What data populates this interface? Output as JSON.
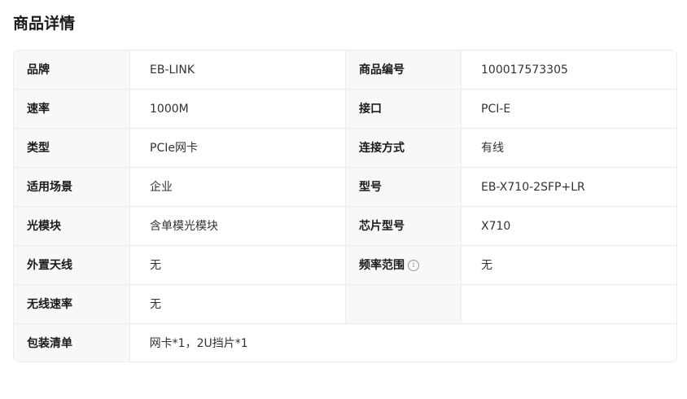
{
  "section": {
    "title": "商品详情"
  },
  "specs": {
    "rows": [
      {
        "k1": "品牌",
        "v1": "EB-LINK",
        "k2": "商品编号",
        "v2": "100017573305"
      },
      {
        "k1": "速率",
        "v1": "1000M",
        "k2": "接口",
        "v2": "PCI-E"
      },
      {
        "k1": "类型",
        "v1": "PCIe网卡",
        "k2": "连接方式",
        "v2": "有线"
      },
      {
        "k1": "适用场景",
        "v1": "企业",
        "k2": "型号",
        "v2": "EB-X710-2SFP+LR"
      },
      {
        "k1": "光模块",
        "v1": "含单模光模块",
        "k2": "芯片型号",
        "v2": "X710"
      },
      {
        "k1": "外置天线",
        "v1": "无",
        "k2": "频率范围",
        "v2": "无"
      },
      {
        "k1": "无线速率",
        "v1": "无",
        "k2": "",
        "v2": ""
      }
    ],
    "last_row": {
      "k1": "包装清单",
      "v1": "网卡*1，2U挡片*1"
    },
    "info_icon_glyph": "i"
  },
  "colors": {
    "key_background": "#f7f8fa",
    "border": "#ececec",
    "text": "#1a1a1a"
  }
}
